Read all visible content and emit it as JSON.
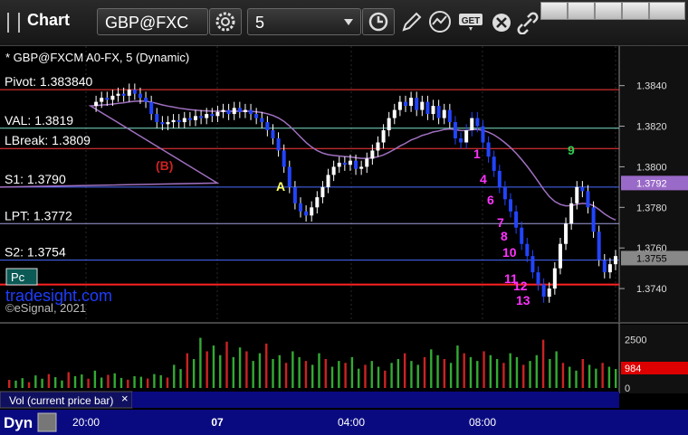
{
  "toolbar": {
    "title": "Chart",
    "symbol": "GBP@FXC",
    "interval": "5"
  },
  "chart_data": {
    "type": "candlestick",
    "symbol_title": "* GBP@FXCM A0-FX, 5 (Dynamic)",
    "x_tick_labels": [
      "20:00",
      "07",
      "04:00",
      "08:00"
    ],
    "y_tick_labels": [
      "1.3840",
      "1.3820",
      "1.3800",
      "1.3780",
      "1.3760",
      "1.3740"
    ],
    "ylim": [
      1.3728,
      1.3855
    ],
    "levels": [
      {
        "label": "Pivot: 1.383840",
        "value": 1.3838,
        "color": "#ff3b3b"
      },
      {
        "label": "VAL: 1.3819",
        "value": 1.3819,
        "color": "#7ee0c8"
      },
      {
        "label": "LBreak: 1.3809",
        "value": 1.3809,
        "color": "#ff3b3b"
      },
      {
        "label": "S1: 1.3790",
        "value": 1.379,
        "color": "#4a6cff"
      },
      {
        "label": "LPT: 1.3772",
        "value": 1.3772,
        "color": "#a0a0e0"
      },
      {
        "label": "S2: 1.3754",
        "value": 1.3754,
        "color": "#4a6cff"
      }
    ],
    "current_price": "1.3755",
    "ma_price": "1.3792",
    "close_path": [
      1.383,
      1.3832,
      1.3834,
      1.3833,
      1.3835,
      1.3836,
      1.3835,
      1.3838,
      1.3836,
      1.3834,
      1.3832,
      1.3826,
      1.3822,
      1.3821,
      1.3822,
      1.3823,
      1.3822,
      1.3824,
      1.3823,
      1.3825,
      1.3824,
      1.3826,
      1.3825,
      1.3827,
      1.3828,
      1.3826,
      1.3829,
      1.3827,
      1.3828,
      1.3826,
      1.3824,
      1.3822,
      1.3818,
      1.3814,
      1.3808,
      1.38,
      1.379,
      1.3782,
      1.3778,
      1.3776,
      1.378,
      1.3785,
      1.379,
      1.3796,
      1.38,
      1.3802,
      1.3801,
      1.3803,
      1.3799,
      1.38,
      1.3804,
      1.3808,
      1.3812,
      1.3818,
      1.3824,
      1.3828,
      1.3832,
      1.383,
      1.3834,
      1.3828,
      1.3832,
      1.3826,
      1.383,
      1.3824,
      1.3828,
      1.3822,
      1.3814,
      1.3812,
      1.3818,
      1.3824,
      1.382,
      1.3812,
      1.3805,
      1.3798,
      1.379,
      1.3784,
      1.3778,
      1.377,
      1.3762,
      1.3756,
      1.3748,
      1.3742,
      1.3736,
      1.374,
      1.375,
      1.3762,
      1.3772,
      1.3782,
      1.379,
      1.3788,
      1.378,
      1.3768,
      1.3754,
      1.3748,
      1.3752,
      1.3756
    ],
    "annotations": [
      {
        "text": "A",
        "color": "#ffff66"
      },
      {
        "text": "(B)",
        "color": "#cc2222"
      },
      {
        "text": "1",
        "color": "#ff33ff"
      },
      {
        "text": "4",
        "color": "#ff33ff"
      },
      {
        "text": "6",
        "color": "#ff33ff"
      },
      {
        "text": "7",
        "color": "#ff33ff"
      },
      {
        "text": "8",
        "color": "#ff33ff"
      },
      {
        "text": "10",
        "color": "#ff33ff"
      },
      {
        "text": "11",
        "color": "#ff33ff"
      },
      {
        "text": "12",
        "color": "#ff33ff"
      },
      {
        "text": "13",
        "color": "#ff33ff"
      },
      {
        "text": "9",
        "color": "#33cc55"
      }
    ],
    "watermark": "tradesight.com",
    "copyright": "©eSignal, 2021",
    "pc_label": "Pc",
    "volume": {
      "label": "Vol (current price bar)",
      "y_tick_labels": [
        "2500",
        "0"
      ],
      "current": "984",
      "ylim": [
        0,
        3000
      ],
      "values": [
        420,
        380,
        510,
        300,
        650,
        480,
        720,
        560,
        390,
        820,
        610,
        700,
        480,
        900,
        540,
        680,
        760,
        520,
        430,
        610,
        580,
        490,
        720,
        660,
        540,
        1200,
        980,
        1800,
        1500,
        2600,
        1900,
        2200,
        1700,
        2400,
        1600,
        2100,
        1900,
        1400,
        1800,
        2300,
        1500,
        1700,
        1300,
        1900,
        1600,
        1400,
        1200,
        1800,
        1500,
        1100,
        1400,
        1300,
        1600,
        1000,
        1200,
        1400,
        1100,
        900,
        1300,
        1500,
        1800,
        1400,
        1200,
        1600,
        2000,
        1700,
        1500,
        1300,
        2200,
        1800,
        1600,
        1400,
        1900,
        1700,
        1500,
        1300,
        1800,
        1600,
        1200,
        1400,
        1700,
        2500,
        1500,
        1900,
        1300,
        1100,
        900,
        1500,
        1200,
        1000,
        1300,
        1100,
        984
      ]
    }
  },
  "bottom": {
    "dyn_label": "Dyn"
  }
}
